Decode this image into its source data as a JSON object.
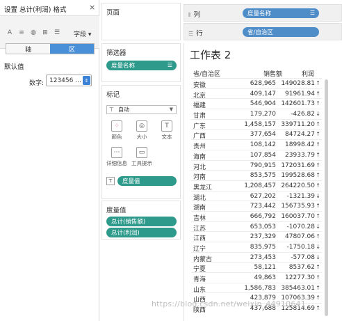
{
  "format_pane": {
    "title": "设置 总计(利润) 格式",
    "close": "×",
    "toolbar": {
      "icons": [
        "A",
        "≡",
        "◍",
        "⊞",
        "☰"
      ],
      "field_menu": "字段 ▾"
    },
    "tabs": [
      "轴",
      "区"
    ],
    "active_tab": "区",
    "section": "默认值",
    "number_label": "数字:",
    "number_value": "123456 ..."
  },
  "pages": {
    "title": "页面"
  },
  "filters": {
    "title": "筛选器",
    "pill": "度量名称"
  },
  "marks": {
    "title": "标记",
    "type": "自动",
    "buttons": [
      {
        "label": "颜色",
        "icon": "color-icon"
      },
      {
        "label": "大小",
        "icon": "size-icon"
      },
      {
        "label": "文本",
        "icon": "text-icon"
      },
      {
        "label": "详细信息",
        "icon": "detail-icon"
      },
      {
        "label": "工具提示",
        "icon": "tooltip-icon"
      }
    ],
    "text_pill": "度量值"
  },
  "measure_values": {
    "title": "度量值",
    "pills": [
      "总计(销售额)",
      "总计(利润)"
    ]
  },
  "shelves": {
    "columns_label": "列",
    "columns_pill": "度量名称",
    "rows_label": "行",
    "rows_pill": "省/自治区"
  },
  "worksheet": {
    "title": "工作表 2",
    "headers": {
      "province": "省/自治区",
      "sales": "销售额",
      "profit": "利润"
    },
    "rows": [
      {
        "province": "安徽",
        "sales": "628,965",
        "profit": "149028.81",
        "arrow": "↑"
      },
      {
        "province": "北京",
        "sales": "409,147",
        "profit": "91961.94",
        "arrow": "↑"
      },
      {
        "province": "福建",
        "sales": "546,904",
        "profit": "142601.73",
        "arrow": "↑"
      },
      {
        "province": "甘肃",
        "sales": "179,270",
        "profit": "-426.82",
        "arrow": "↓"
      },
      {
        "province": "广东",
        "sales": "1,458,157",
        "profit": "339711.20",
        "arrow": "↑"
      },
      {
        "province": "广西",
        "sales": "377,654",
        "profit": "84724.27",
        "arrow": "↑"
      },
      {
        "province": "贵州",
        "sales": "108,142",
        "profit": "18998.42",
        "arrow": "↑"
      },
      {
        "province": "海南",
        "sales": "107,854",
        "profit": "23933.79",
        "arrow": "↑"
      },
      {
        "province": "河北",
        "sales": "790,915",
        "profit": "172031.69",
        "arrow": "↑"
      },
      {
        "province": "河南",
        "sales": "853,575",
        "profit": "199528.68",
        "arrow": "↑"
      },
      {
        "province": "黑龙江",
        "sales": "1,208,457",
        "profit": "264220.50",
        "arrow": "↑"
      },
      {
        "province": "湖北",
        "sales": "627,202",
        "profit": "-1321.39",
        "arrow": "↓"
      },
      {
        "province": "湖南",
        "sales": "723,442",
        "profit": "156735.93",
        "arrow": "↑"
      },
      {
        "province": "吉林",
        "sales": "666,792",
        "profit": "160037.70",
        "arrow": "↑"
      },
      {
        "province": "江苏",
        "sales": "653,053",
        "profit": "-1070.28",
        "arrow": "↓"
      },
      {
        "province": "江西",
        "sales": "237,329",
        "profit": "47807.06",
        "arrow": "↑"
      },
      {
        "province": "辽宁",
        "sales": "835,975",
        "profit": "-1750.18",
        "arrow": "↓"
      },
      {
        "province": "内蒙古",
        "sales": "273,453",
        "profit": "-577.08",
        "arrow": "↓"
      },
      {
        "province": "宁夏",
        "sales": "58,121",
        "profit": "8537.62",
        "arrow": "↑"
      },
      {
        "province": "青海",
        "sales": "49,863",
        "profit": "12277.30",
        "arrow": "↑"
      },
      {
        "province": "山东",
        "sales": "1,586,783",
        "profit": "385463.01",
        "arrow": "↑"
      },
      {
        "province": "山西",
        "sales": "423,879",
        "profit": "107063.39",
        "arrow": "↑"
      },
      {
        "province": "陕西",
        "sales": "437,688",
        "profit": "125814.69",
        "arrow": "↑"
      }
    ]
  },
  "watermark": "https://blog.csdn.net/weixin_44910641",
  "colors": {
    "pill_green": "#2e9a8b",
    "pill_blue": "#4f8dc9",
    "active_tab": "#4a90d9"
  }
}
